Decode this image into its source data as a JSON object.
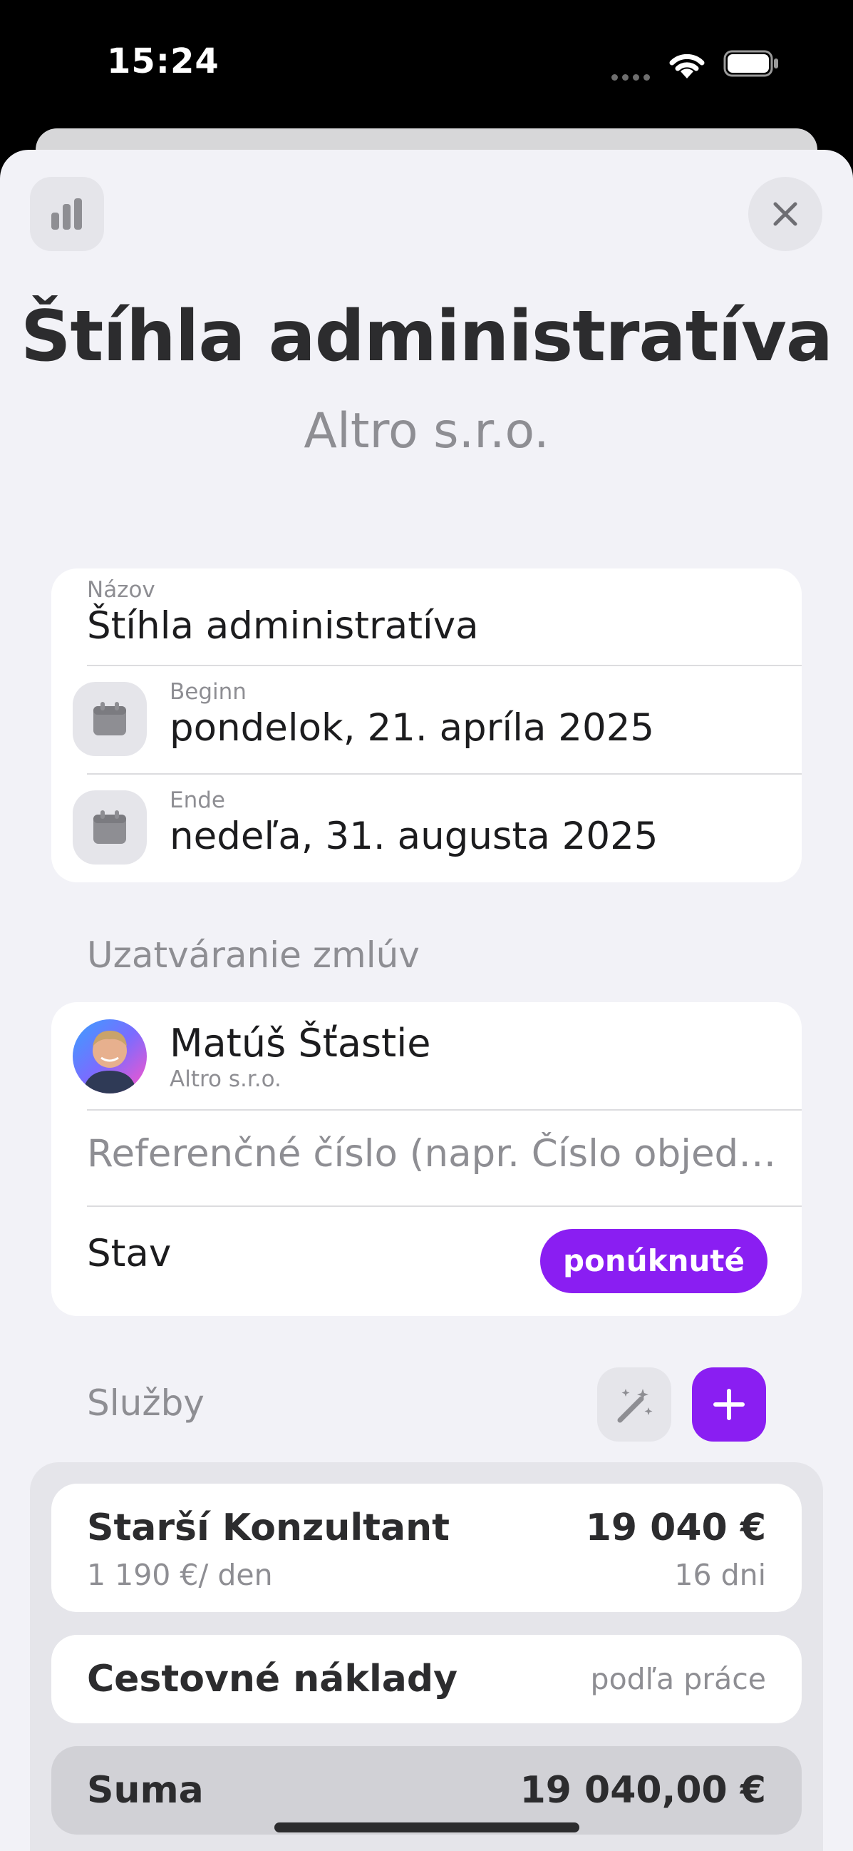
{
  "status_bar": {
    "time": "15:24",
    "icons": [
      "signal-dots-icon",
      "wifi-icon",
      "battery-icon"
    ]
  },
  "toolbar": {
    "left_icon": "bar-chart-icon",
    "right_icon": "close-icon"
  },
  "header": {
    "title": "Štíhla administratíva",
    "subtitle": "Altro s.r.o."
  },
  "details": {
    "name_label": "Názov",
    "name_value": "Štíhla administratíva",
    "begin_label": "Beginn",
    "begin_value": "pondelok, 21. apríla 2025",
    "end_label": "Ende",
    "end_value": "nedeľa, 31. augusta 2025",
    "date_icon": "calendar-icon"
  },
  "contracting": {
    "header": "Uzatváranie zmlúv",
    "contact_name": "Matúš Šťastie",
    "contact_company": "Altro s.r.o.",
    "reference_placeholder": "Referenčné číslo (napr. Číslo objednávky)",
    "status_label": "Stav",
    "status_value": "ponúknuté"
  },
  "services": {
    "header": "Služby",
    "magic_icon": "magic-wand-icon",
    "add_icon": "plus-icon",
    "items": [
      {
        "name": "Starší Konzultant",
        "rate": "1 190 €/ den",
        "total": "19 040 €",
        "duration": "16 dni"
      },
      {
        "name": "Cestovné náklady",
        "note": "podľa práce"
      }
    ],
    "sum_label": "Suma",
    "sum_value": "19 040,00 €"
  },
  "colors": {
    "accent": "#8a1ef2",
    "background": "#f2f2f7",
    "card": "#ffffff",
    "secondary_text": "#8e8e93"
  }
}
